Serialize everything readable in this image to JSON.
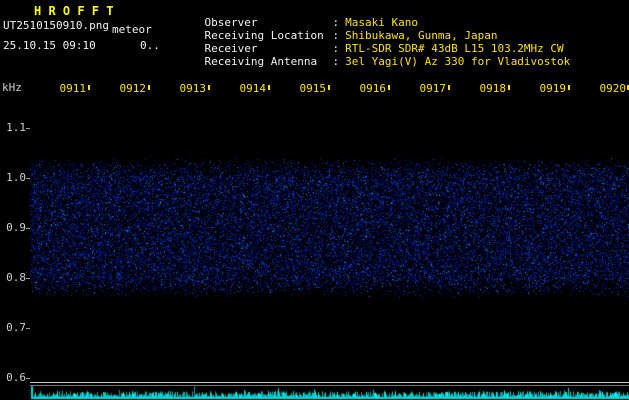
{
  "header": {
    "title": "H R O F F T",
    "filename": "UT2510150910.png",
    "mode": "meteor",
    "datetime": "25.10.15 09:10",
    "counter": "0..",
    "separator": ":",
    "info": [
      {
        "label": "Observer",
        "value": "Masaki Kano"
      },
      {
        "label": "Receiving Location",
        "value": "Shibukawa, Gunma, Japan"
      },
      {
        "label": "Receiver",
        "value": "RTL-SDR SDR# 43dB L15 103.2MHz CW"
      },
      {
        "label": "Receiving Antenna",
        "value": "3el Yagi(V) Az 330 for Vladivostok"
      }
    ]
  },
  "axes": {
    "freq_unit": "kHz",
    "freq_ticks": [
      "1.1",
      "1.0",
      "0.9",
      "0.8",
      "0.7",
      "0.6"
    ],
    "time_ticks": [
      "0911",
      "0912",
      "0913",
      "0914",
      "0915",
      "0916",
      "0917",
      "0918",
      "0919",
      "0920"
    ]
  },
  "chart_data": {
    "type": "heatmap",
    "title": "HROFFT 10-minute meteor radio echo spectrogram",
    "x_ticks": [
      "0911",
      "0912",
      "0913",
      "0914",
      "0915",
      "0916",
      "0917",
      "0918",
      "0919",
      "0920"
    ],
    "x_unit": "UT hhmm",
    "y_unit": "kHz",
    "y_ticks": [
      1.1,
      1.0,
      0.9,
      0.8,
      0.7,
      0.6
    ],
    "y_range": [
      0.58,
      1.17
    ],
    "noise_band_khz": [
      0.78,
      1.02
    ],
    "noise_band_peak_khz": 0.9,
    "content": "Continuous broadband blue noise band centered near 0.9 kHz spanning the full 10 minutes; no distinct meteor echo streaks visible",
    "signal_level_strip": "flat low-amplitude cyan noise trace along the bottom edge",
    "palette": {
      "background": "#000000",
      "noise_dim": "#000a5a",
      "noise_base": "#0012a0",
      "noise_mid": "#1232d2",
      "noise_bright": "#2a5aff",
      "noise_hot": "#00b4ff",
      "level_trace": "#00d8d8"
    }
  }
}
